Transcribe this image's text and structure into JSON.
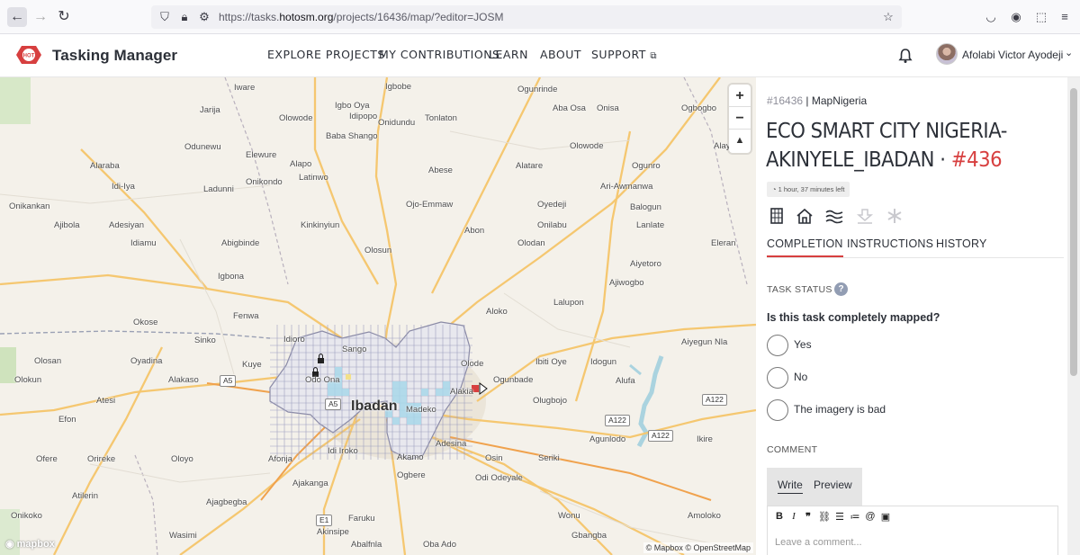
{
  "browser": {
    "url_prefix": "https://tasks.",
    "url_domain": "hotosm.org",
    "url_path": "/projects/16436/map/?editor=JOSM"
  },
  "header": {
    "brand": "Tasking Manager",
    "logo_text": "HOT",
    "nav": [
      "EXPLORE PROJECTS",
      "MY CONTRIBUTIONS",
      "LEARN",
      "ABOUT",
      "SUPPORT"
    ],
    "user_name": "Afolabi Victor Ayodeji"
  },
  "map": {
    "labels": [
      "Igbobe",
      "Ogunrinde",
      "Iware",
      "Jarija",
      "Igbo Oya",
      "Aba Osa",
      "Onisa",
      "Olowode",
      "Idipopo",
      "Onidundu",
      "Tonlaton",
      "Ogbogbo",
      "Alaya",
      "Baba Shango",
      "Odunewu",
      "Elewure",
      "Olowode",
      "Alaraba",
      "Alapo",
      "Latinwo",
      "Abese",
      "Alatare",
      "Ogunro",
      "Idi-Iya",
      "Ladunni",
      "Onikondo",
      "Ari-Awmanwa",
      "Onikankan",
      "Ojo-Emmaw",
      "Oyedeji",
      "Balogun",
      "Ajibola",
      "Adesiyan",
      "Kinkinyiun",
      "Abon",
      "Onilabu",
      "Lanlate",
      "Idiamu",
      "Abigbinde",
      "Olodan",
      "Eleran",
      "Olosun",
      "Aiyetoro",
      "Igbona",
      "Ajiwogbo",
      "Lalupon",
      "Fenwa",
      "Okose",
      "Aloko",
      "Sinko",
      "Idioro",
      "Sango",
      "Aiyegun Nla",
      "Olosan",
      "Oyadina",
      "Kuye",
      "Ibiti Oye",
      "Idogun",
      "Olokun",
      "Alakaso",
      "Olode",
      "Ogunbade",
      "Alufa",
      "Atesi",
      "Odo Ona",
      "Alakia",
      "Olugbojo",
      "Efon",
      "Madeko",
      "Agunlodo",
      "Ikire",
      "Oloyo",
      "Idi Iroko",
      "Adesina",
      "Orireke",
      "Ofere",
      "Afonja",
      "Akamo",
      "Osin",
      "Seriki",
      "Ajakanga",
      "Ogbere",
      "Odi Odeyale",
      "Atilerin",
      "Ajagbegba",
      "Akinsipe",
      "Onikoko",
      "Faruku",
      "Wonu",
      "Amoloko",
      "Wasimi",
      "Gbangba",
      "Abalfnla",
      "Oba Ado"
    ],
    "city": "Ibadan",
    "road_shields": [
      "A5",
      "A5",
      "A122",
      "A122",
      "A122",
      "E1"
    ],
    "zoom_in": "+",
    "zoom_out": "−",
    "compass": "▲",
    "brand": "mapbox",
    "attribution": "© Mapbox © OpenStreetMap"
  },
  "panel": {
    "project_id": "#16436",
    "project_sep": " | ",
    "org": "MapNigeria",
    "title": "ECO SMART CITY NIGERIA-AKINYELE_IBADAN · ",
    "task_number": "#436",
    "time_left": "1 hour, 37 minutes left",
    "tool_icons": [
      "building-icon",
      "home-icon",
      "waterway-icon",
      "landuse-icon",
      "asterisk-icon"
    ],
    "tabs": [
      "COMPLETION",
      "INSTRUCTIONS",
      "HISTORY"
    ],
    "task_status_label": "TASK STATUS",
    "question": "Is this task completely mapped?",
    "options": [
      "Yes",
      "No",
      "The imagery is bad"
    ],
    "comment_label": "COMMENT",
    "editor_tabs": [
      "Write",
      "Preview"
    ],
    "toolbar": [
      "B",
      "I",
      "❞",
      "🔗",
      "☰",
      "≔",
      "@",
      "▣"
    ],
    "comment_placeholder": "Leave a comment..."
  }
}
